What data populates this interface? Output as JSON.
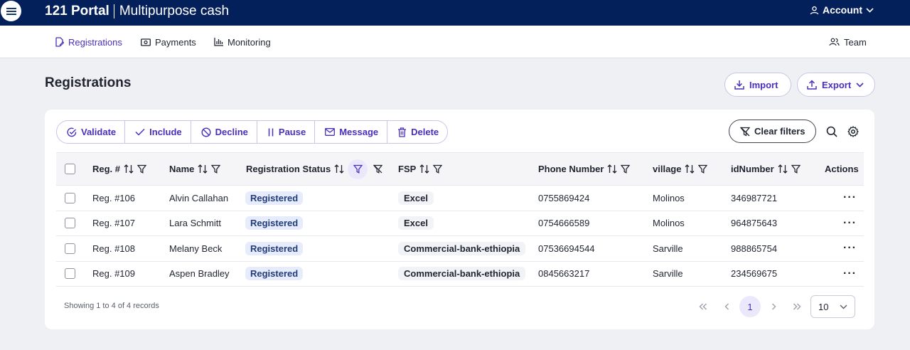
{
  "topbar": {
    "brand_bold": "121 Portal",
    "brand_rest": "Multipurpose cash",
    "account_label": "Account"
  },
  "nav": {
    "registrations": "Registrations",
    "payments": "Payments",
    "monitoring": "Monitoring",
    "team": "Team"
  },
  "page": {
    "title": "Registrations",
    "import_label": "Import",
    "export_label": "Export"
  },
  "actions": {
    "validate": "Validate",
    "include": "Include",
    "decline": "Decline",
    "pause": "Pause",
    "message": "Message",
    "delete": "Delete",
    "clear_filters": "Clear filters"
  },
  "table": {
    "headers": {
      "reg": "Reg. #",
      "name": "Name",
      "status": "Registration Status",
      "fsp": "FSP",
      "phone": "Phone Number",
      "village": "village",
      "id": "idNumber",
      "actions": "Actions"
    },
    "rows": [
      {
        "reg": "Reg. #106",
        "name": "Alvin Callahan",
        "status": "Registered",
        "fsp": "Excel",
        "phone": "0755869424",
        "village": "Molinos",
        "id": "346987721"
      },
      {
        "reg": "Reg. #107",
        "name": "Lara Schmitt",
        "status": "Registered",
        "fsp": "Excel",
        "phone": "0754666589",
        "village": "Molinos",
        "id": "964875643"
      },
      {
        "reg": "Reg. #108",
        "name": "Melany Beck",
        "status": "Registered",
        "fsp": "Commercial-bank-ethiopia",
        "phone": "07536694544",
        "village": "Sarville",
        "id": "988865754"
      },
      {
        "reg": "Reg. #109",
        "name": "Aspen Bradley",
        "status": "Registered",
        "fsp": "Commercial-bank-ethiopia",
        "phone": "0845663217",
        "village": "Sarville",
        "id": "234569675"
      }
    ]
  },
  "footer": {
    "records": "Showing 1 to 4 of 4 records",
    "current_page": "1",
    "page_size": "10"
  },
  "colors": {
    "topbar": "#04205a",
    "accent": "#4a2fbd",
    "status_tag_bg": "#e6ecfb"
  }
}
